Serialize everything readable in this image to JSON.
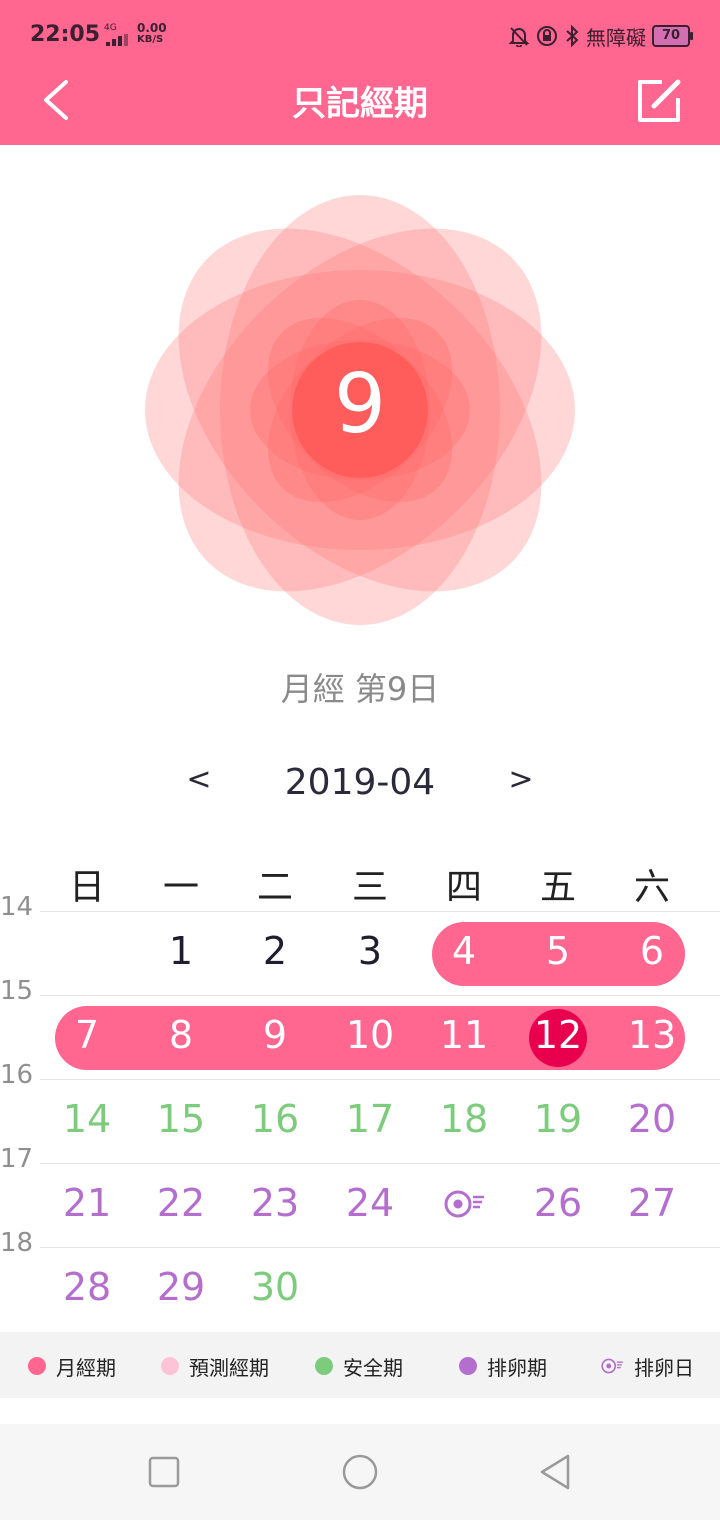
{
  "status_bar": {
    "time": "22:05",
    "network": "4G",
    "speed_value": "0.00",
    "speed_unit": "KB/S",
    "accessibility": "無障礙",
    "battery": "70"
  },
  "header": {
    "title": "只記經期",
    "back_icon": "chevron-left-icon",
    "edit_icon": "edit-icon"
  },
  "summary": {
    "day_number": "9",
    "period_text": "月經 第9日"
  },
  "calendar": {
    "prev_label": "<",
    "month": "2019-04",
    "next_label": ">",
    "weekdays": [
      "日",
      "一",
      "二",
      "三",
      "四",
      "五",
      "六"
    ],
    "week_numbers": [
      "14",
      "15",
      "16",
      "17",
      "18"
    ],
    "days": {
      "d1": "1",
      "d2": "2",
      "d3": "3",
      "d4": "4",
      "d5": "5",
      "d6": "6",
      "d7": "7",
      "d8": "8",
      "d9": "9",
      "d10": "10",
      "d11": "11",
      "d12": "12",
      "d13": "13",
      "d14": "14",
      "d15": "15",
      "d16": "16",
      "d17": "17",
      "d18": "18",
      "d19": "19",
      "d20": "20",
      "d21": "21",
      "d22": "22",
      "d23": "23",
      "d24": "24",
      "d26": "26",
      "d27": "27",
      "d28": "28",
      "d29": "29",
      "d30": "30"
    },
    "ovulation_day": "25",
    "today": "12",
    "colors": {
      "period": "#FF6690",
      "today": "#E8004F",
      "safe": "#7DCB7C",
      "ovulation": "#B46FCE",
      "predicted": "#FFC3D8"
    }
  },
  "legend": {
    "period": "月經期",
    "predicted": "預測經期",
    "safe": "安全期",
    "ovulation_period": "排卵期",
    "ovulation_day": "排卵日"
  },
  "nav_bar": {
    "icons": [
      "square-icon",
      "circle-icon",
      "triangle-back-icon"
    ]
  }
}
